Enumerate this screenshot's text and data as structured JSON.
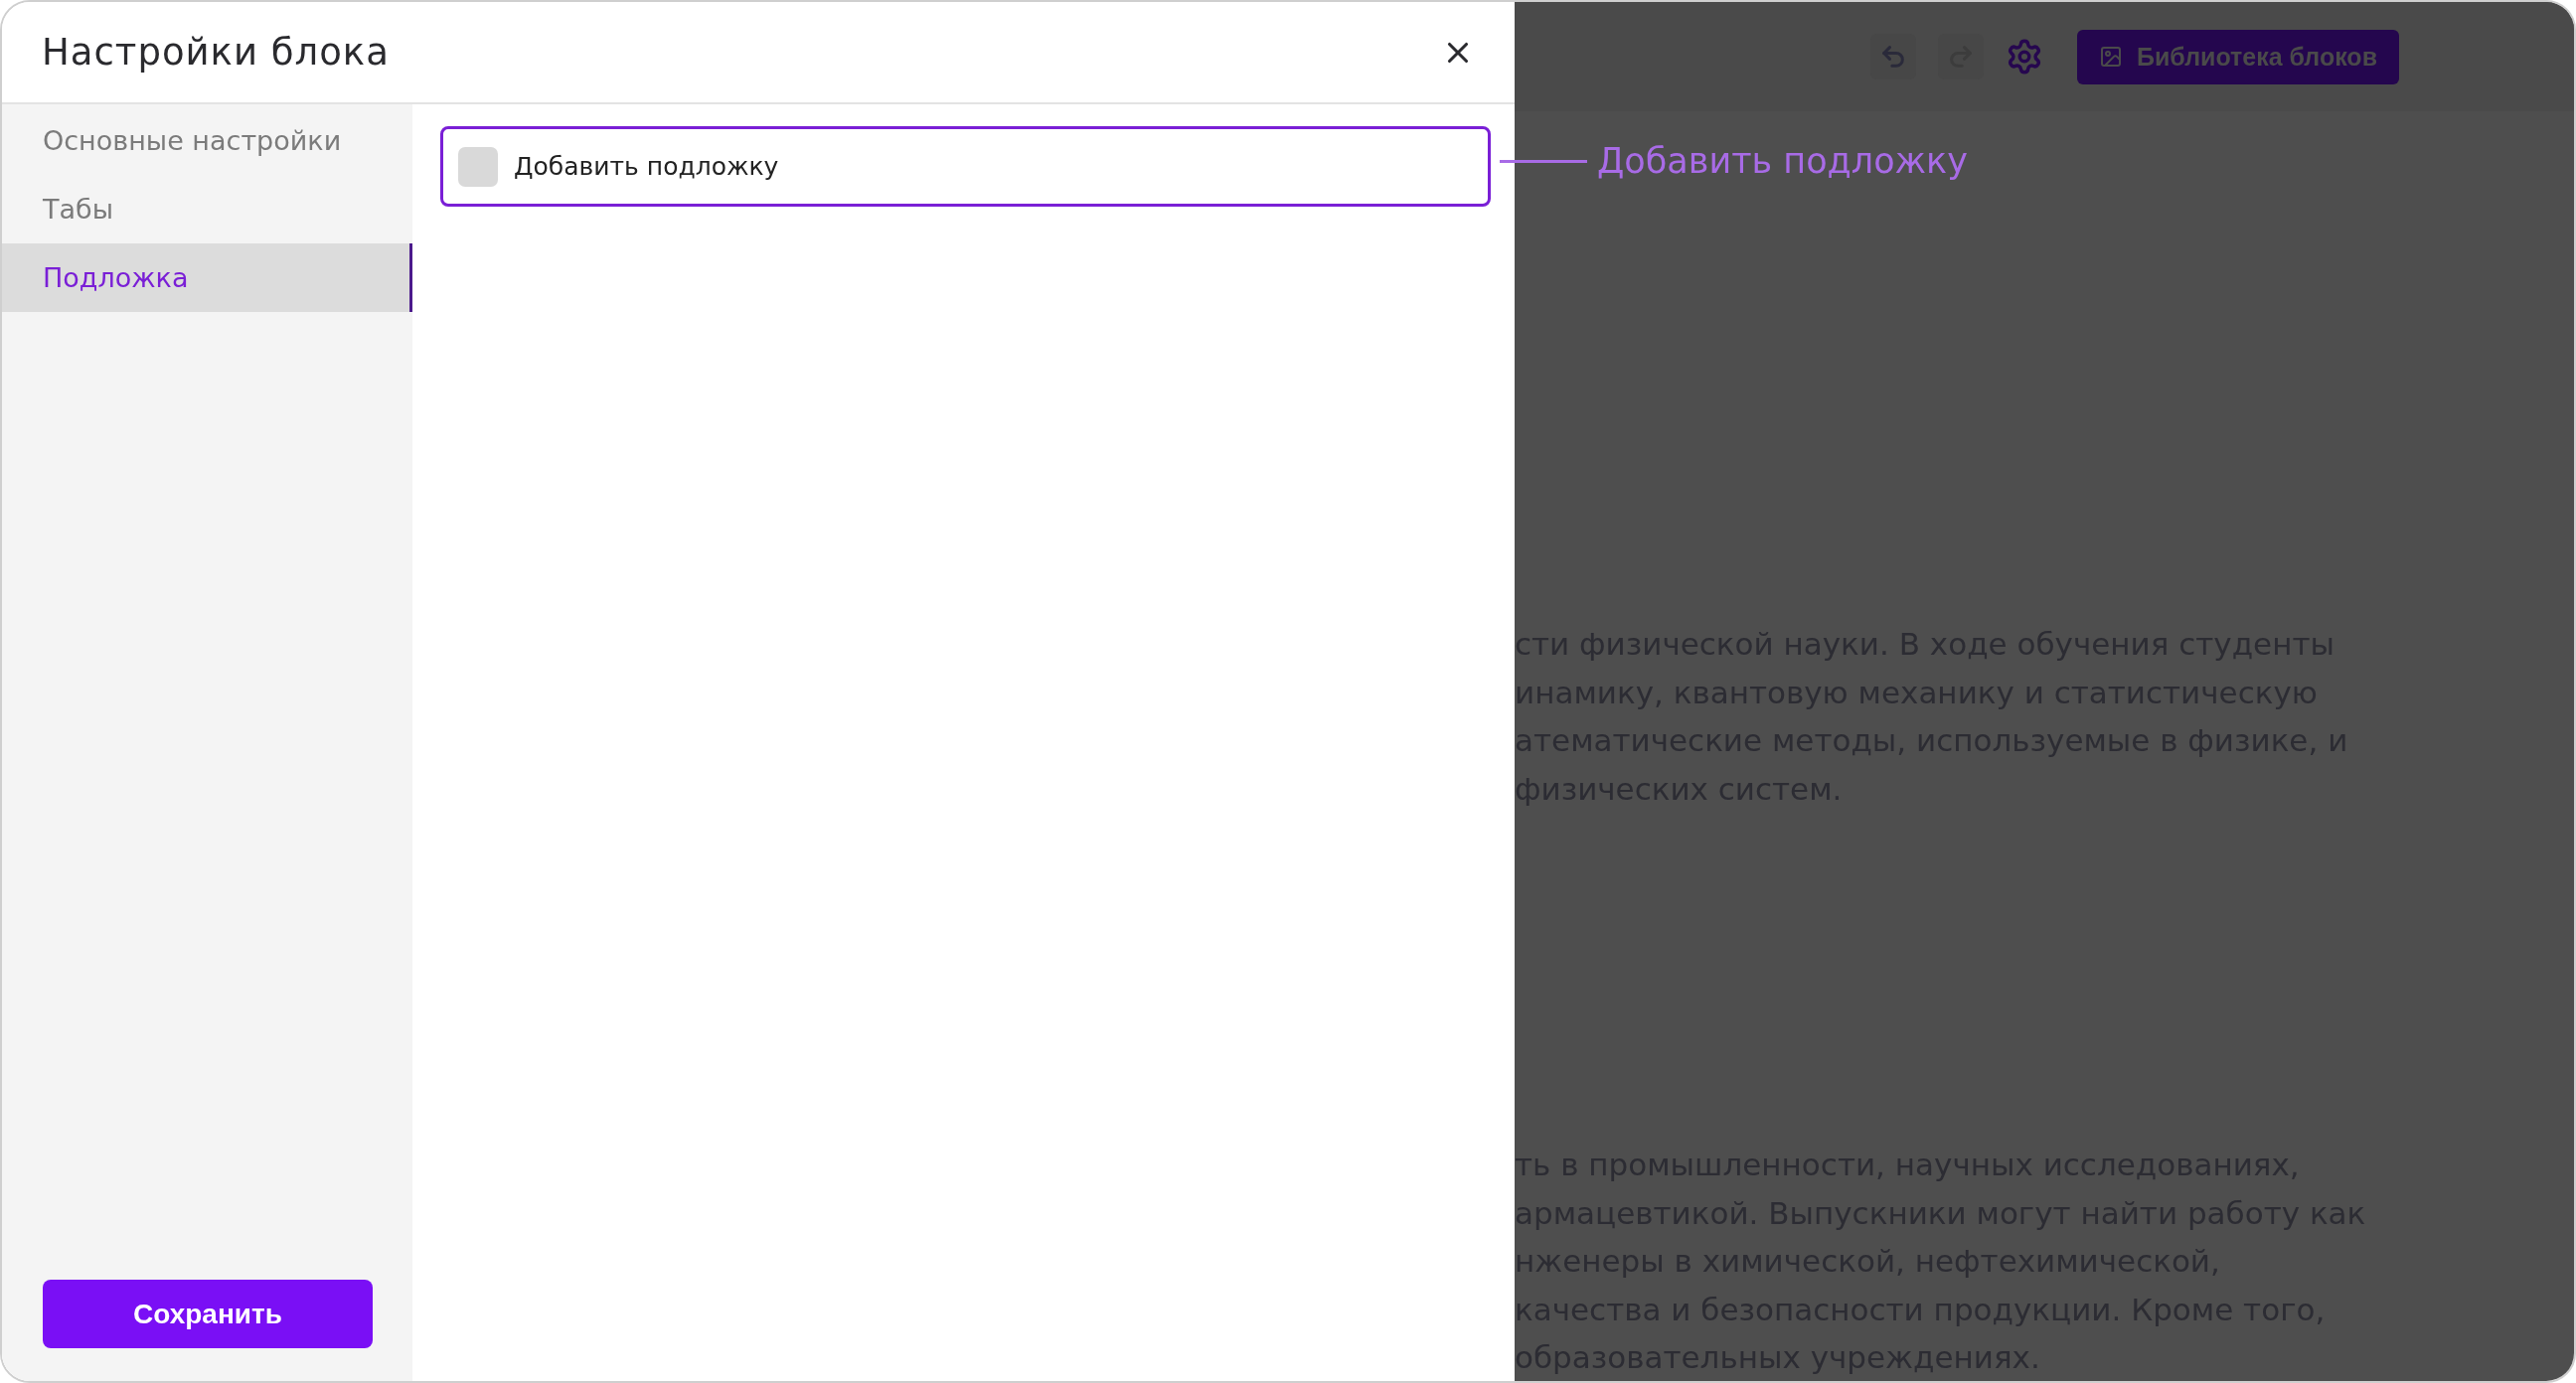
{
  "dialog": {
    "title": "Настройки блока"
  },
  "sidebar": {
    "items": [
      {
        "label": "Основные настройки",
        "selected": false
      },
      {
        "label": "Табы",
        "selected": false
      },
      {
        "label": "Подложка",
        "selected": true
      }
    ]
  },
  "options": [
    {
      "label": "Добавить подложку",
      "checked": false,
      "focused": true
    }
  ],
  "save_button": "Сохранить",
  "annotation": "Добавить подложку",
  "background": {
    "toolbar": {
      "library_button": "Библиотека блоков"
    },
    "paragraphs": [
      [
        "сти физической науки. В ходе обучения студенты",
        "инамику, квантовую механику и статистическую",
        "атематические методы, используемые в физике, и",
        "физических систем."
      ],
      [
        "ть в промышленности, научных исследованиях,",
        "армацевтикой. Выпускники могут найти работу как",
        "нженеры в химической, нефтехимической,",
        "качества и безопасности продукции. Кроме того,",
        "образовательных учреждениях."
      ]
    ]
  }
}
